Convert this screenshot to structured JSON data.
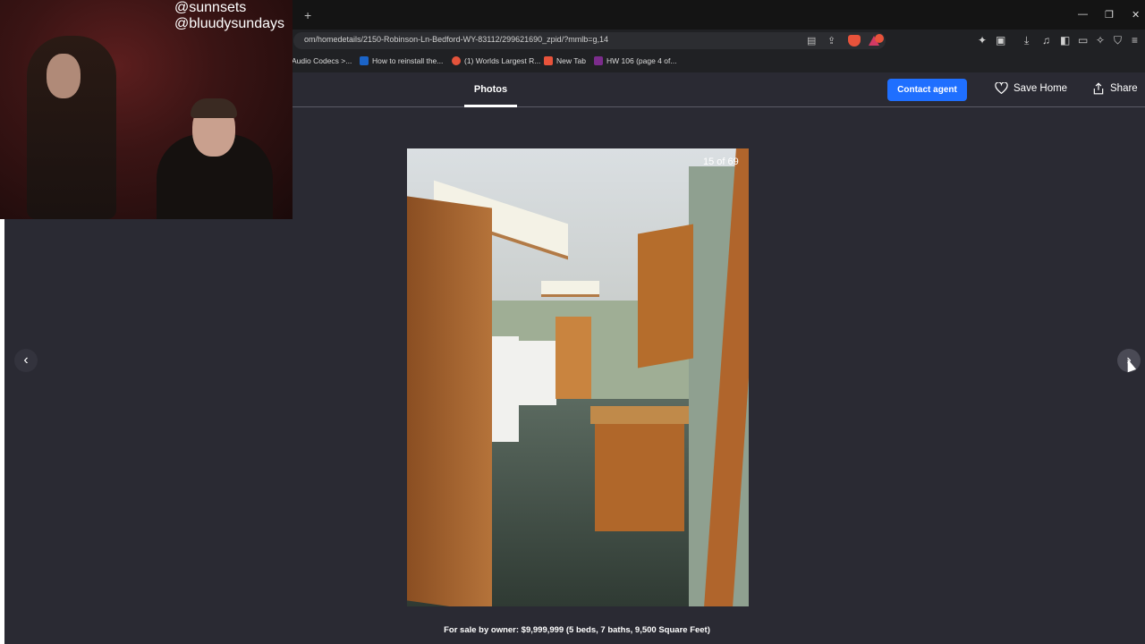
{
  "browser": {
    "url": "om/homedetails/2150-Robinson-Ln-Bedford-WY-83112/299621690_zpid/?mmlb=g,14",
    "newtab": "+",
    "bookmarks": [
      {
        "label": "Audio Codecs >...",
        "color": "#2b2b2b"
      },
      {
        "label": "How to reinstall the...",
        "color": "#1b64c8"
      },
      {
        "label": "(1) Worlds Largest R...",
        "color": "#e4533b"
      },
      {
        "label": "New Tab",
        "color": "#e8533b"
      },
      {
        "label": "HW 106 (page 4 of...",
        "color": "#7b2c8c"
      }
    ]
  },
  "header": {
    "tab_photos": "Photos",
    "contact": "Contact agent",
    "save": "Save Home",
    "share": "Share"
  },
  "overlay": {
    "handle1": "@sunnsets",
    "handle2": "@bluudysundays"
  },
  "viewer": {
    "counter": "15 of 69",
    "prev": "‹",
    "next": "›",
    "caption": "For sale by owner: $9,999,999 (5 beds, 7 baths, 9,500 Square Feet)"
  }
}
